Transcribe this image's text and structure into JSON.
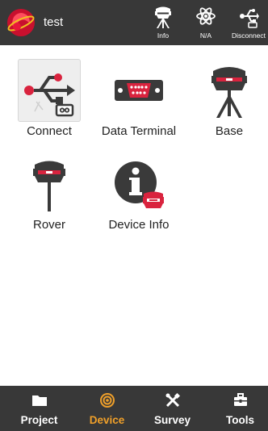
{
  "header": {
    "title": "test",
    "buttons": [
      {
        "label": "Info",
        "icon": "gnss-receiver-icon"
      },
      {
        "label": "N/A",
        "icon": "atom-icon"
      },
      {
        "label": "Disconnect",
        "icon": "usb-icon"
      }
    ]
  },
  "grid": {
    "items": [
      {
        "label": "Connect",
        "icon": "usb-connect-icon",
        "selected": true
      },
      {
        "label": "Data Terminal",
        "icon": "serial-port-icon"
      },
      {
        "label": "Base",
        "icon": "base-receiver-icon"
      },
      {
        "label": "Rover",
        "icon": "rover-receiver-icon"
      },
      {
        "label": "Device Info",
        "icon": "device-info-icon"
      }
    ]
  },
  "bottom_nav": {
    "items": [
      {
        "label": "Project",
        "icon": "folder-icon",
        "active": false
      },
      {
        "label": "Device",
        "icon": "device-radio-icon",
        "active": true
      },
      {
        "label": "Survey",
        "icon": "survey-tools-icon",
        "active": false
      },
      {
        "label": "Tools",
        "icon": "toolbox-icon",
        "active": false
      }
    ]
  },
  "colors": {
    "bar": "#383838",
    "accent": "#f0a02a",
    "brand_red": "#d9233e"
  }
}
